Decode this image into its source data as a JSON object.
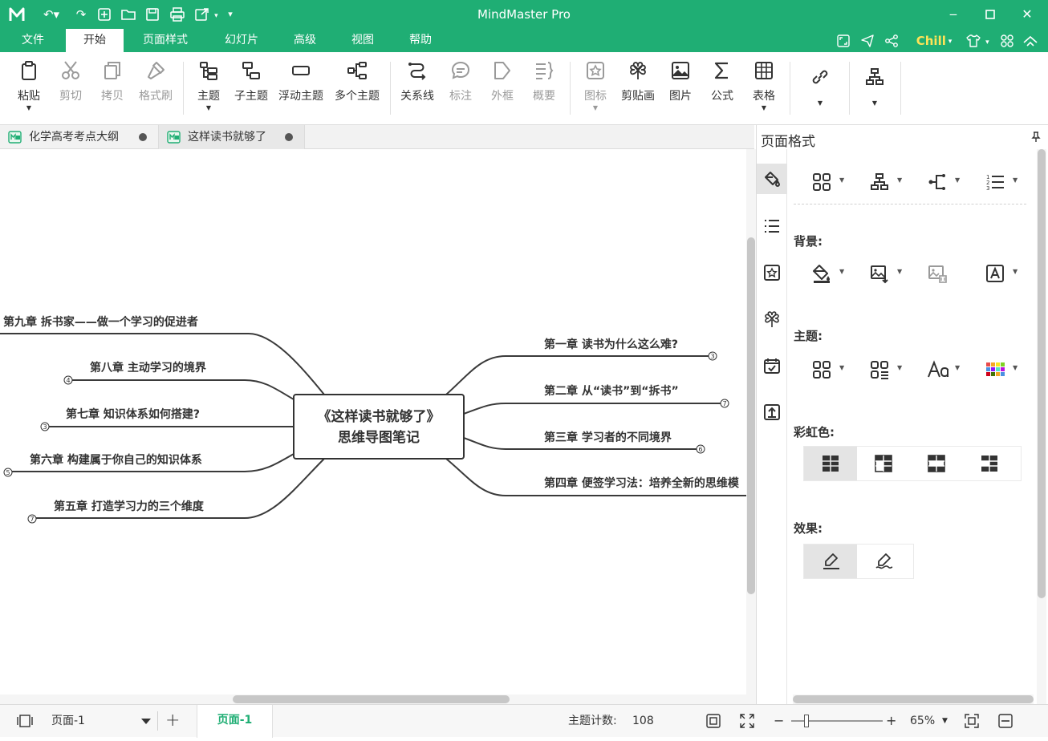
{
  "app": {
    "title": "MindMaster Pro"
  },
  "menu": {
    "items": [
      "文件",
      "开始",
      "页面样式",
      "幻灯片",
      "高级",
      "视图",
      "帮助"
    ],
    "active": "开始",
    "theme_label": "Chill"
  },
  "ribbon": {
    "paste": "粘贴",
    "cut": "剪切",
    "copy": "拷贝",
    "format_painter": "格式刷",
    "topic": "主题",
    "subtopic": "子主题",
    "floating_topic": "浮动主题",
    "multi_topic": "多个主题",
    "relationship": "关系线",
    "callout": "标注",
    "boundary": "外框",
    "summary": "概要",
    "icon": "图标",
    "clipart": "剪贴画",
    "picture": "图片",
    "formula": "公式",
    "table": "表格"
  },
  "doc_tabs": [
    {
      "label": "化学高考考点大纲"
    },
    {
      "label": "这样读书就够了"
    }
  ],
  "mindmap": {
    "central": [
      "《这样读书就够了》",
      "思维导图笔记"
    ],
    "right": [
      {
        "label": "第一章 读书为什么这么难?",
        "count": "3"
      },
      {
        "label": "第二章 从“读书”到“拆书”",
        "count": "7"
      },
      {
        "label": "第三章 学习者的不同境界",
        "count": "6"
      },
      {
        "label": "第四章 便签学习法：培养全新的思维模",
        "count": ""
      }
    ],
    "left": [
      {
        "label": "第九章 拆书家——做一个学习的促进者",
        "count": ""
      },
      {
        "label": "第八章 主动学习的境界",
        "count": "4"
      },
      {
        "label": "第七章 知识体系如何搭建?",
        "count": "3"
      },
      {
        "label": "第六章 构建属于你自己的知识体系",
        "count": "5"
      },
      {
        "label": "第五章 打造学习力的三个维度",
        "count": "7"
      }
    ]
  },
  "panel": {
    "title": "页面格式",
    "background_label": "背景:",
    "theme_label": "主题:",
    "rainbow_label": "彩虹色:",
    "effect_label": "效果:"
  },
  "statusbar": {
    "page_select": "页面-1",
    "page_tab": "页面-1",
    "topic_count_label": "主题计数:",
    "topic_count": "108",
    "zoom": "65%"
  },
  "colors": {
    "accent": "#1fae74",
    "theme_label": "#ffe357"
  }
}
